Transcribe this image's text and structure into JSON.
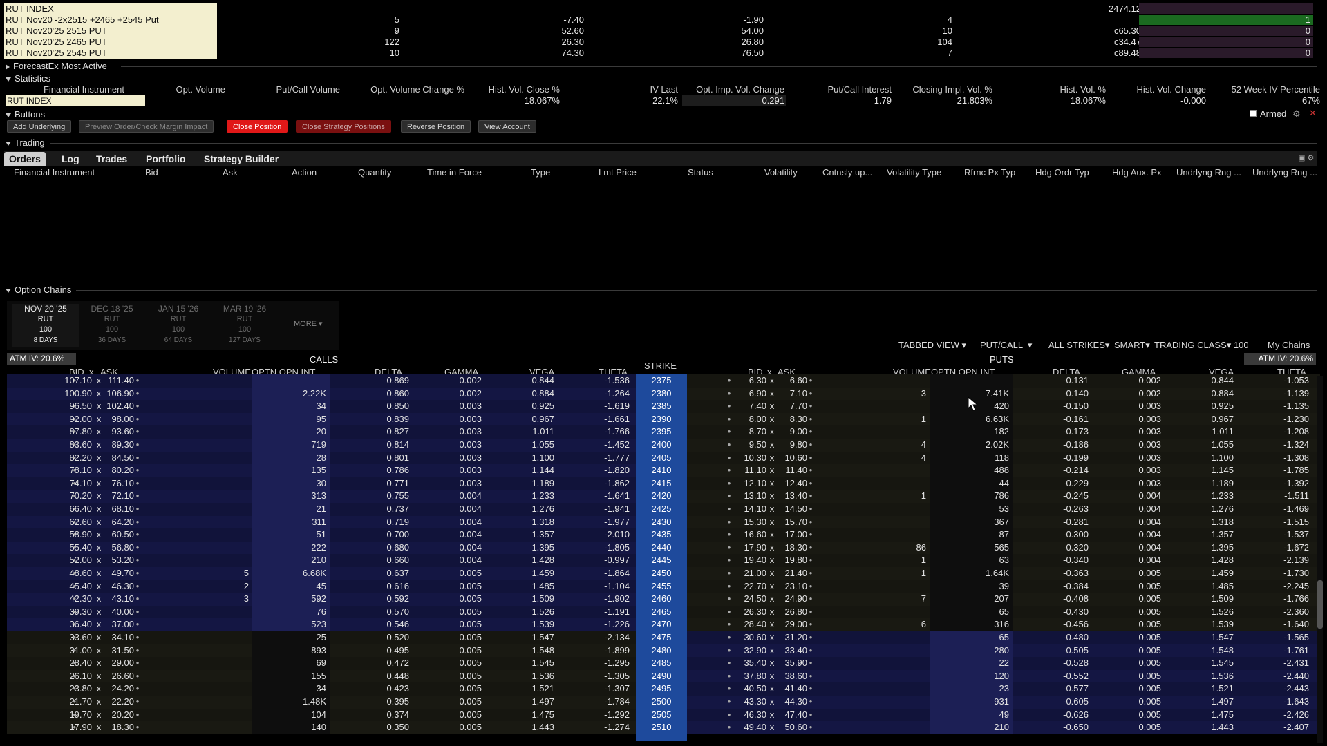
{
  "positions": [
    {
      "name": "RUT INDEX",
      "c1": "",
      "c2": "",
      "c3": "",
      "c4": "",
      "c5": "2474.12",
      "pos": ""
    },
    {
      "name": "RUT Nov20 -2x2515 +2465 +2545 Put",
      "c1": "5",
      "c2": "-7.40",
      "c3": "-1.90",
      "c4": "4",
      "c5": "",
      "pos": "1"
    },
    {
      "name": "RUT Nov20'25 2515 PUT",
      "c1": "9",
      "c2": "52.60",
      "c3": "54.00",
      "c4": "10",
      "c5": "c65.30",
      "pos": "0"
    },
    {
      "name": "RUT Nov20'25 2465 PUT",
      "c1": "122",
      "c2": "26.30",
      "c3": "26.80",
      "c4": "104",
      "c5": "c34.47",
      "pos": "0"
    },
    {
      "name": "RUT Nov20'25 2545 PUT",
      "c1": "10",
      "c2": "74.30",
      "c3": "76.50",
      "c4": "7",
      "c5": "c89.48",
      "pos": "0"
    }
  ],
  "sections": {
    "forecastex": "ForecastEx Most Active",
    "statistics": "Statistics",
    "buttons": "Buttons",
    "trading": "Trading",
    "option_chains": "Option Chains"
  },
  "statistics": {
    "headers": [
      "Financial Instrument",
      "Opt. Volume",
      "Put/Call Volume",
      "Opt. Volume Change %",
      "Hist. Vol. Close %",
      "IV Last",
      "Opt. Imp. Vol. Change",
      "Put/Call Interest",
      "Closing Impl. Vol. %",
      "Hist. Vol. %",
      "Hist. Vol. Change",
      "52 Week IV Percentile"
    ],
    "instrument": "RUT INDEX",
    "values": [
      "",
      "",
      "",
      "",
      "18.067%",
      "22.1%",
      "0.291",
      "1.79",
      "21.803%",
      "18.067%",
      "-0.000",
      "67%"
    ]
  },
  "buttons": {
    "add_underlying": "Add Underlying",
    "preview": "Preview Order/Check Margin Impact",
    "close_position": "Close Position",
    "close_strategy": "Close Strategy Positions",
    "reverse": "Reverse Position",
    "view_account": "View Account",
    "armed": "Armed"
  },
  "trading_tabs": [
    "Orders",
    "Log",
    "Trades",
    "Portfolio",
    "Strategy Builder"
  ],
  "orders_headers": [
    "Financial Instrument",
    "Bid",
    "Ask",
    "Action",
    "Quantity",
    "Time in Force",
    "Type",
    "Lmt Price",
    "Status",
    "Volatility",
    "Cntnsly up...",
    "Volatility Type",
    "Rfrnc Px Typ",
    "Hdg Ordr Typ",
    "Hdg Aux. Px",
    "Undrlyng Rng ...",
    "Undrlyng Rng ..."
  ],
  "expiries": [
    {
      "date": "NOV 20 '25",
      "sym": "RUT",
      "mult": "100",
      "days": "8 DAYS"
    },
    {
      "date": "DEC 18 '25",
      "sym": "RUT",
      "mult": "100",
      "days": "36 DAYS"
    },
    {
      "date": "JAN 15 '26",
      "sym": "RUT",
      "mult": "100",
      "days": "64 DAYS"
    },
    {
      "date": "MAR 19 '26",
      "sym": "RUT",
      "mult": "100",
      "days": "127 DAYS"
    }
  ],
  "more": "MORE",
  "chain_toolbar": {
    "view": "TABBED VIEW",
    "putcall": "PUT/CALL",
    "strikes": "ALL STRIKES",
    "exchange": "SMART",
    "trading_class": "TRADING CLASS",
    "trading_class_value": "100",
    "my_chains": "My Chains"
  },
  "atm_iv": "ATM IV: 20.6%",
  "calls_label": "CALLS",
  "puts_label": "PUTS",
  "strike_label": "STRIKE",
  "call_headers": [
    "BID",
    "x",
    "ASK",
    "VOLUME",
    "OPTN OPN INT...",
    "DELTA",
    "GAMMA",
    "VEGA",
    "THETA"
  ],
  "put_headers": [
    "BID",
    "x",
    "ASK",
    "VOLUME",
    "OPTN OPN INT...",
    "DELTA",
    "GAMMA",
    "VEGA",
    "THETA"
  ],
  "chain": [
    {
      "cb": "107.10",
      "ca": "111.40",
      "cv": "",
      "coi": "",
      "cd": "0.869",
      "cg": "0.002",
      "cvg": "0.844",
      "ct": "-1.536",
      "k": "2375",
      "pb": "6.30",
      "pa": "6.60",
      "pv": "",
      "poi": "",
      "pd": "-0.131",
      "pg": "0.002",
      "pvg": "0.844",
      "pt": "-1.053"
    },
    {
      "cb": "100.90",
      "ca": "106.90",
      "cv": "",
      "coi": "2.22K",
      "cd": "0.860",
      "cg": "0.002",
      "cvg": "0.884",
      "ct": "-1.264",
      "k": "2380",
      "pb": "6.90",
      "pa": "7.10",
      "pv": "3",
      "poi": "7.41K",
      "pd": "-0.140",
      "pg": "0.002",
      "pvg": "0.884",
      "pt": "-1.139"
    },
    {
      "cb": "96.50",
      "ca": "102.40",
      "cv": "",
      "coi": "34",
      "cd": "0.850",
      "cg": "0.003",
      "cvg": "0.925",
      "ct": "-1.619",
      "k": "2385",
      "pb": "7.40",
      "pa": "7.70",
      "pv": "",
      "poi": "420",
      "pd": "-0.150",
      "pg": "0.003",
      "pvg": "0.925",
      "pt": "-1.135"
    },
    {
      "cb": "92.00",
      "ca": "98.00",
      "cv": "",
      "coi": "95",
      "cd": "0.839",
      "cg": "0.003",
      "cvg": "0.967",
      "ct": "-1.661",
      "k": "2390",
      "pb": "8.00",
      "pa": "8.30",
      "pv": "1",
      "poi": "6.63K",
      "pd": "-0.161",
      "pg": "0.003",
      "pvg": "0.967",
      "pt": "-1.230"
    },
    {
      "cb": "87.80",
      "ca": "93.60",
      "cv": "",
      "coi": "20",
      "cd": "0.827",
      "cg": "0.003",
      "cvg": "1.011",
      "ct": "-1.766",
      "k": "2395",
      "pb": "8.70",
      "pa": "9.00",
      "pv": "",
      "poi": "182",
      "pd": "-0.173",
      "pg": "0.003",
      "pvg": "1.011",
      "pt": "-1.208"
    },
    {
      "cb": "83.60",
      "ca": "89.30",
      "cv": "",
      "coi": "719",
      "cd": "0.814",
      "cg": "0.003",
      "cvg": "1.055",
      "ct": "-1.452",
      "k": "2400",
      "pb": "9.50",
      "pa": "9.80",
      "pv": "4",
      "poi": "2.02K",
      "pd": "-0.186",
      "pg": "0.003",
      "pvg": "1.055",
      "pt": "-1.324"
    },
    {
      "cb": "82.20",
      "ca": "84.50",
      "cv": "",
      "coi": "28",
      "cd": "0.801",
      "cg": "0.003",
      "cvg": "1.100",
      "ct": "-1.777",
      "k": "2405",
      "pb": "10.30",
      "pa": "10.60",
      "pv": "4",
      "poi": "118",
      "pd": "-0.199",
      "pg": "0.003",
      "pvg": "1.100",
      "pt": "-1.308"
    },
    {
      "cb": "78.10",
      "ca": "80.20",
      "cv": "",
      "coi": "135",
      "cd": "0.786",
      "cg": "0.003",
      "cvg": "1.144",
      "ct": "-1.820",
      "k": "2410",
      "pb": "11.10",
      "pa": "11.40",
      "pv": "",
      "poi": "488",
      "pd": "-0.214",
      "pg": "0.003",
      "pvg": "1.145",
      "pt": "-1.785"
    },
    {
      "cb": "74.10",
      "ca": "76.10",
      "cv": "",
      "coi": "30",
      "cd": "0.771",
      "cg": "0.003",
      "cvg": "1.189",
      "ct": "-1.862",
      "k": "2415",
      "pb": "12.10",
      "pa": "12.40",
      "pv": "",
      "poi": "44",
      "pd": "-0.229",
      "pg": "0.003",
      "pvg": "1.189",
      "pt": "-1.392"
    },
    {
      "cb": "70.20",
      "ca": "72.10",
      "cv": "",
      "coi": "313",
      "cd": "0.755",
      "cg": "0.004",
      "cvg": "1.233",
      "ct": "-1.641",
      "k": "2420",
      "pb": "13.10",
      "pa": "13.40",
      "pv": "1",
      "poi": "786",
      "pd": "-0.245",
      "pg": "0.004",
      "pvg": "1.233",
      "pt": "-1.511"
    },
    {
      "cb": "66.40",
      "ca": "68.10",
      "cv": "",
      "coi": "21",
      "cd": "0.737",
      "cg": "0.004",
      "cvg": "1.276",
      "ct": "-1.941",
      "k": "2425",
      "pb": "14.10",
      "pa": "14.50",
      "pv": "",
      "poi": "53",
      "pd": "-0.263",
      "pg": "0.004",
      "pvg": "1.276",
      "pt": "-1.469"
    },
    {
      "cb": "62.60",
      "ca": "64.20",
      "cv": "",
      "coi": "311",
      "cd": "0.719",
      "cg": "0.004",
      "cvg": "1.318",
      "ct": "-1.977",
      "k": "2430",
      "pb": "15.30",
      "pa": "15.70",
      "pv": "",
      "poi": "367",
      "pd": "-0.281",
      "pg": "0.004",
      "pvg": "1.318",
      "pt": "-1.515"
    },
    {
      "cb": "58.90",
      "ca": "60.50",
      "cv": "",
      "coi": "51",
      "cd": "0.700",
      "cg": "0.004",
      "cvg": "1.357",
      "ct": "-2.010",
      "k": "2435",
      "pb": "16.60",
      "pa": "17.00",
      "pv": "",
      "poi": "87",
      "pd": "-0.300",
      "pg": "0.004",
      "pvg": "1.357",
      "pt": "-1.537"
    },
    {
      "cb": "55.40",
      "ca": "56.80",
      "cv": "",
      "coi": "222",
      "cd": "0.680",
      "cg": "0.004",
      "cvg": "1.395",
      "ct": "-1.805",
      "k": "2440",
      "pb": "17.90",
      "pa": "18.30",
      "pv": "86",
      "poi": "565",
      "pd": "-0.320",
      "pg": "0.004",
      "pvg": "1.395",
      "pt": "-1.672"
    },
    {
      "cb": "52.00",
      "ca": "53.20",
      "cv": "",
      "coi": "210",
      "cd": "0.660",
      "cg": "0.004",
      "cvg": "1.428",
      "ct": "-0.997",
      "k": "2445",
      "pb": "19.40",
      "pa": "19.80",
      "pv": "1",
      "poi": "63",
      "pd": "-0.340",
      "pg": "0.004",
      "pvg": "1.428",
      "pt": "-2.139"
    },
    {
      "cb": "48.60",
      "ca": "49.70",
      "cv": "5",
      "coi": "6.68K",
      "cd": "0.637",
      "cg": "0.005",
      "cvg": "1.459",
      "ct": "-1.864",
      "k": "2450",
      "pb": "21.00",
      "pa": "21.40",
      "pv": "1",
      "poi": "1.64K",
      "pd": "-0.363",
      "pg": "0.005",
      "pvg": "1.459",
      "pt": "-1.730"
    },
    {
      "cb": "45.40",
      "ca": "46.30",
      "cv": "2",
      "coi": "45",
      "cd": "0.616",
      "cg": "0.005",
      "cvg": "1.485",
      "ct": "-1.104",
      "k": "2455",
      "pb": "22.70",
      "pa": "23.10",
      "pv": "",
      "poi": "39",
      "pd": "-0.384",
      "pg": "0.005",
      "pvg": "1.485",
      "pt": "-2.245"
    },
    {
      "cb": "42.30",
      "ca": "43.10",
      "cv": "3",
      "coi": "592",
      "cd": "0.592",
      "cg": "0.005",
      "cvg": "1.509",
      "ct": "-1.902",
      "k": "2460",
      "pb": "24.50",
      "pa": "24.90",
      "pv": "7",
      "poi": "207",
      "pd": "-0.408",
      "pg": "0.005",
      "pvg": "1.509",
      "pt": "-1.766"
    },
    {
      "cb": "39.30",
      "ca": "40.00",
      "cv": "",
      "coi": "76",
      "cd": "0.570",
      "cg": "0.005",
      "cvg": "1.526",
      "ct": "-1.191",
      "k": "2465",
      "pb": "26.30",
      "pa": "26.80",
      "pv": "",
      "poi": "65",
      "pd": "-0.430",
      "pg": "0.005",
      "pvg": "1.526",
      "pt": "-2.360"
    },
    {
      "cb": "36.40",
      "ca": "37.00",
      "cv": "",
      "coi": "523",
      "cd": "0.546",
      "cg": "0.005",
      "cvg": "1.539",
      "ct": "-1.226",
      "k": "2470",
      "pb": "28.40",
      "pa": "29.00",
      "pv": "6",
      "poi": "316",
      "pd": "-0.456",
      "pg": "0.005",
      "pvg": "1.539",
      "pt": "-1.640"
    },
    {
      "cb": "33.60",
      "ca": "34.10",
      "cv": "",
      "coi": "25",
      "cd": "0.520",
      "cg": "0.005",
      "cvg": "1.547",
      "ct": "-2.134",
      "k": "2475",
      "pb": "30.60",
      "pa": "31.20",
      "pv": "",
      "poi": "65",
      "pd": "-0.480",
      "pg": "0.005",
      "pvg": "1.547",
      "pt": "-1.565"
    },
    {
      "cb": "31.00",
      "ca": "31.50",
      "cv": "",
      "coi": "893",
      "cd": "0.495",
      "cg": "0.005",
      "cvg": "1.548",
      "ct": "-1.899",
      "k": "2480",
      "pb": "32.90",
      "pa": "33.40",
      "pv": "",
      "poi": "280",
      "pd": "-0.505",
      "pg": "0.005",
      "pvg": "1.548",
      "pt": "-1.761"
    },
    {
      "cb": "28.40",
      "ca": "29.00",
      "cv": "",
      "coi": "69",
      "cd": "0.472",
      "cg": "0.005",
      "cvg": "1.545",
      "ct": "-1.295",
      "k": "2485",
      "pb": "35.40",
      "pa": "35.90",
      "pv": "",
      "poi": "22",
      "pd": "-0.528",
      "pg": "0.005",
      "pvg": "1.545",
      "pt": "-2.431"
    },
    {
      "cb": "26.10",
      "ca": "26.60",
      "cv": "",
      "coi": "155",
      "cd": "0.448",
      "cg": "0.005",
      "cvg": "1.536",
      "ct": "-1.305",
      "k": "2490",
      "pb": "37.80",
      "pa": "38.60",
      "pv": "",
      "poi": "120",
      "pd": "-0.552",
      "pg": "0.005",
      "pvg": "1.536",
      "pt": "-2.440"
    },
    {
      "cb": "23.80",
      "ca": "24.20",
      "cv": "",
      "coi": "34",
      "cd": "0.423",
      "cg": "0.005",
      "cvg": "1.521",
      "ct": "-1.307",
      "k": "2495",
      "pb": "40.50",
      "pa": "41.40",
      "pv": "",
      "poi": "23",
      "pd": "-0.577",
      "pg": "0.005",
      "pvg": "1.521",
      "pt": "-2.443"
    },
    {
      "cb": "21.70",
      "ca": "22.20",
      "cv": "",
      "coi": "1.48K",
      "cd": "0.395",
      "cg": "0.005",
      "cvg": "1.497",
      "ct": "-1.784",
      "k": "2500",
      "pb": "43.30",
      "pa": "44.30",
      "pv": "",
      "poi": "931",
      "pd": "-0.605",
      "pg": "0.005",
      "pvg": "1.497",
      "pt": "-1.643"
    },
    {
      "cb": "19.70",
      "ca": "20.20",
      "cv": "",
      "coi": "104",
      "cd": "0.374",
      "cg": "0.005",
      "cvg": "1.475",
      "ct": "-1.292",
      "k": "2505",
      "pb": "46.30",
      "pa": "47.40",
      "pv": "",
      "poi": "49",
      "pd": "-0.626",
      "pg": "0.005",
      "pvg": "1.475",
      "pt": "-2.426"
    },
    {
      "cb": "17.90",
      "ca": "18.30",
      "cv": "",
      "coi": "140",
      "cd": "0.350",
      "cg": "0.005",
      "cvg": "1.443",
      "ct": "-1.274",
      "k": "2510",
      "pb": "49.40",
      "pa": "50.60",
      "pv": "",
      "poi": "210",
      "pd": "-0.650",
      "pg": "0.005",
      "pvg": "1.443",
      "pt": "-2.407"
    }
  ]
}
